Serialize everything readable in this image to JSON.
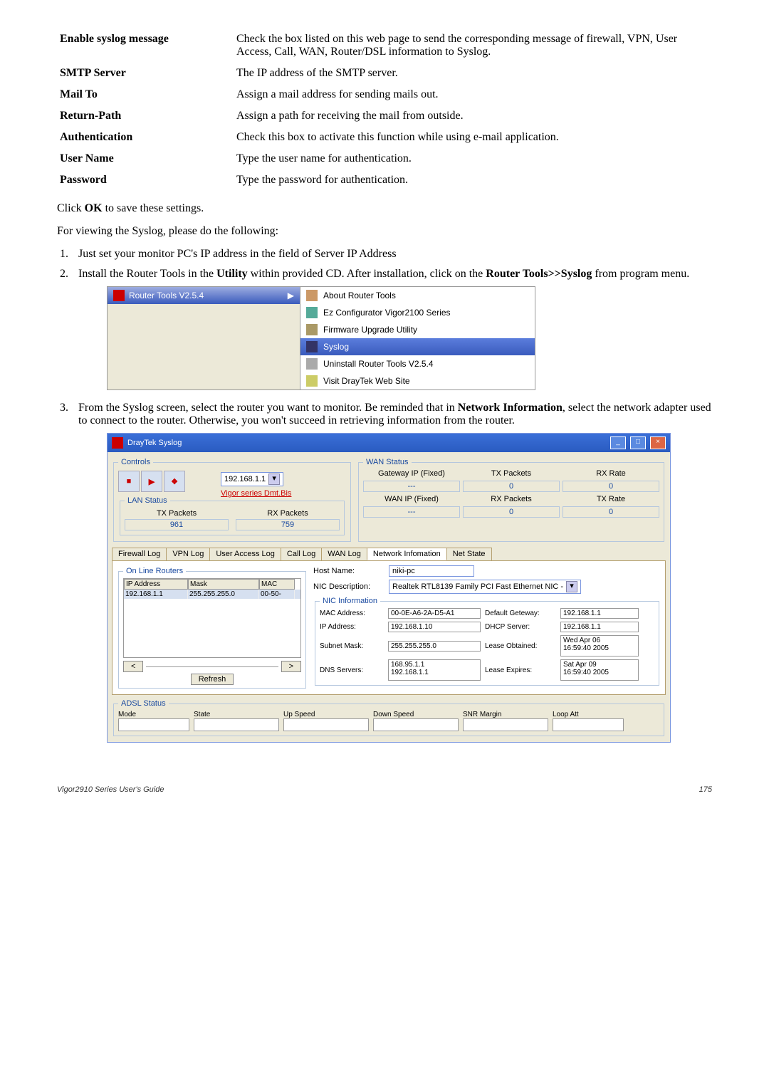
{
  "definitions": [
    {
      "term": "Enable syslog message",
      "desc": "Check the box listed on this web page to send the corresponding message of firewall, VPN, User Access, Call, WAN, Router/DSL information to Syslog."
    },
    {
      "term": "SMTP Server",
      "desc": "The IP address of the SMTP server."
    },
    {
      "term": "Mail To",
      "desc": "Assign a mail address for sending mails out."
    },
    {
      "term": "Return-Path",
      "desc": "Assign a path for receiving the mail from outside."
    },
    {
      "term": "Authentication",
      "desc": "Check this box to activate this function while using e-mail application."
    },
    {
      "term": "User Name",
      "desc": "Type the user name for authentication."
    },
    {
      "term": "Password",
      "desc": "Type the password for authentication."
    }
  ],
  "click_ok_line_pre": "Click ",
  "click_ok_bold": "OK",
  "click_ok_line_post": " to save these settings.",
  "viewing_line": "For viewing the Syslog, please do the following:",
  "step1": "Just set your monitor PC's IP address in the field of Server IP Address",
  "step2_pre": "Install the Router Tools in the ",
  "step2_b1": "Utility",
  "step2_mid": " within provided CD. After installation, click on the ",
  "step2_b2": "Router Tools>>Syslog",
  "step2_post": " from program menu.",
  "menu": {
    "title": "Router Tools V2.5.4",
    "items": [
      "About Router Tools",
      "Ez Configurator Vigor2100 Series",
      "Firmware Upgrade Utility",
      "Syslog",
      "Uninstall Router Tools V2.5.4",
      "Visit DrayTek Web Site"
    ]
  },
  "step3_pre": "From the Syslog screen, select the router you want to monitor. Be reminded that in ",
  "step3_b1": "Network Information",
  "step3_post": ", select the network adapter used to connect to the router. Otherwise, you won't succeed in retrieving information from the router.",
  "app": {
    "title": "DrayTek Syslog",
    "controls": {
      "legend": "Controls",
      "ip": "192.168.1.1",
      "product": "Vigor series Dmt.Bis"
    },
    "lan": {
      "legend": "LAN Status",
      "tx_label": "TX Packets",
      "tx_value": "961",
      "rx_label": "RX Packets",
      "rx_value": "759"
    },
    "wan": {
      "legend": "WAN Status",
      "rows": [
        {
          "c1": "Gateway IP (Fixed)",
          "c2": "TX Packets",
          "c3": "RX Rate"
        },
        {
          "c1": "---",
          "c2": "0",
          "c3": "0"
        },
        {
          "c1": "WAN IP (Fixed)",
          "c2": "RX Packets",
          "c3": "TX Rate"
        },
        {
          "c1": "---",
          "c2": "0",
          "c3": "0"
        }
      ]
    },
    "tabs": [
      "Firewall Log",
      "VPN Log",
      "User Access Log",
      "Call Log",
      "WAN Log",
      "Network Infomation",
      "Net State"
    ],
    "active_tab_index": 5,
    "olr": {
      "legend": "On Line Routers",
      "headers": [
        "IP Address",
        "Mask",
        "MAC"
      ],
      "row": [
        "192.168.1.1",
        "255.255.255.0",
        "00-50-"
      ],
      "refresh": "Refresh"
    },
    "nic": {
      "host_label": "Host Name:",
      "host_val": "niki-pc",
      "desc_label": "NIC Description:",
      "desc_val": "Realtek RTL8139 Family PCI Fast Ethernet NIC -",
      "info_legend": "NIC Information",
      "mac_label": "MAC Address:",
      "mac_val": "00-0E-A6-2A-D5-A1",
      "ip_label": "IP Address:",
      "ip_val": "192.168.1.10",
      "sub_label": "Subnet Mask:",
      "sub_val": "255.255.255.0",
      "dns_label": "DNS Servers:",
      "dns_val": "168.95.1.1\n192.168.1.1",
      "defgw_label": "Default Geteway:",
      "defgw_val": "192.168.1.1",
      "dhcp_label": "DHCP Server:",
      "dhcp_val": "192.168.1.1",
      "lob_label": "Lease Obtained:",
      "lob_val": "Wed Apr 06\n16:59:40 2005",
      "lex_label": "Lease Expires:",
      "lex_val": "Sat Apr 09\n16:59:40 2005"
    },
    "adsl": {
      "legend": "ADSL Status",
      "labels": [
        "Mode",
        "State",
        "Up Speed",
        "Down Speed",
        "SNR Margin",
        "Loop Att"
      ]
    }
  },
  "footer_left": "Vigor2910 Series User's Guide",
  "footer_right": "175"
}
